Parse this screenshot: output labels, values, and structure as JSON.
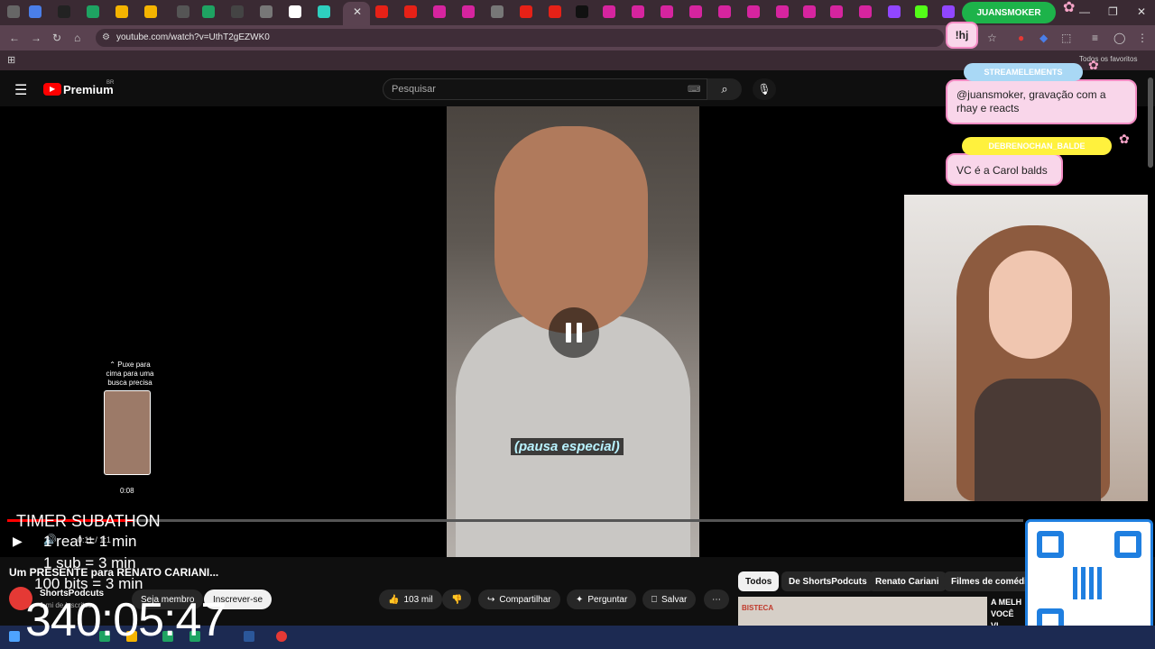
{
  "browser": {
    "url": "youtube.com/watch?v=UthT2gEZWK0",
    "bookmarks_label": "Todos os favoritos"
  },
  "youtube": {
    "logo_text": "Premium",
    "logo_region": "BR",
    "search_placeholder": "Pesquisar"
  },
  "player": {
    "caption": "(pausa especial)",
    "thumb_tip": "Puxe para cima para uma busca precisa",
    "thumb_time": "0:08",
    "time_display": "0:11 / 1:1"
  },
  "video": {
    "title": "Um PRESENTE para RENATO CARIANI...",
    "channel": "ShortsPodcuts",
    "subscribers": "1 mi de inscritos",
    "member_label": "Seja membro",
    "subscribe_label": "Inscrever-se",
    "likes": "103 mil",
    "share_label": "Compartilhar",
    "ask_label": "Perguntar",
    "save_label": "Salvar"
  },
  "recommendations": {
    "chips": [
      "Todos",
      "De ShortsPodcuts",
      "Renato Cariani",
      "Filmes de comédia"
    ],
    "first_title": "A MELH VOCÊ VI",
    "first_thumb_text": "BISTECA"
  },
  "timer": {
    "title": "TIMER SUBATHON",
    "lines": [
      "1 real = 1 min",
      "1 sub = 3 min",
      "100 bits = 3 min"
    ],
    "clock": "340:05:47"
  },
  "stream_overlay": {
    "juan_badge": "JUANSMOKER",
    "hj_message": "!hj",
    "badge1": "STREAMELEMENTS",
    "message1": "@juansmoker, gravação com a rhay e reacts",
    "badge2": "DEBRENOCHAN_BALDE",
    "message2": "VC é a Carol balds"
  },
  "colors": {
    "youtube_red": "#ff0000",
    "chat_bubble": "#f9d6ea",
    "chat_border": "#f38cc4",
    "qr_blue": "#1f7fe0",
    "caption_cyan": "#b9f3ff"
  }
}
